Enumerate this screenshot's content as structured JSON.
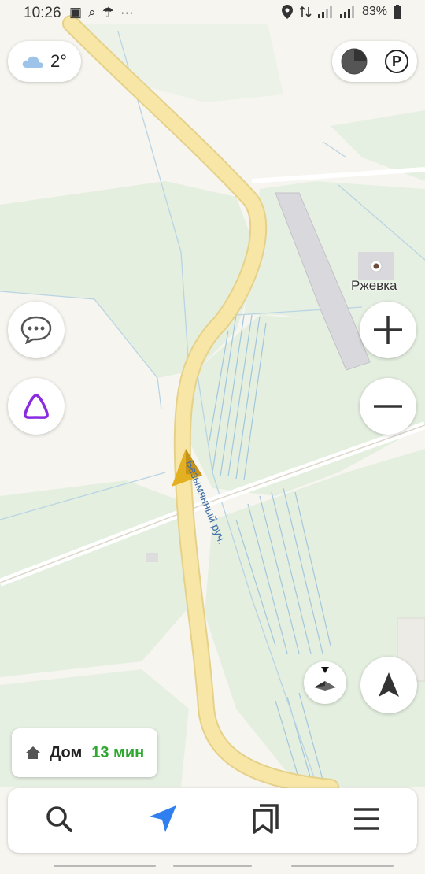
{
  "status_bar": {
    "time": "10:26",
    "battery": "83%"
  },
  "weather": {
    "temperature": "2°",
    "icon": "cloud-icon"
  },
  "map": {
    "place_label": "Ржевка",
    "creek_label": "Безымянный руч.",
    "colors": {
      "forest": "#e4efe0",
      "field": "#f6f5ef",
      "road": "#f7e6a6",
      "road_edge": "#e6d18a",
      "water": "#9cc2dd",
      "accent": "#2f7ff0"
    }
  },
  "home_chip": {
    "label": "Дом",
    "eta": "13 мин"
  },
  "bottom_bar": {
    "items": [
      "search-icon",
      "navigator-icon",
      "bookmarks-icon",
      "menu-icon"
    ]
  }
}
